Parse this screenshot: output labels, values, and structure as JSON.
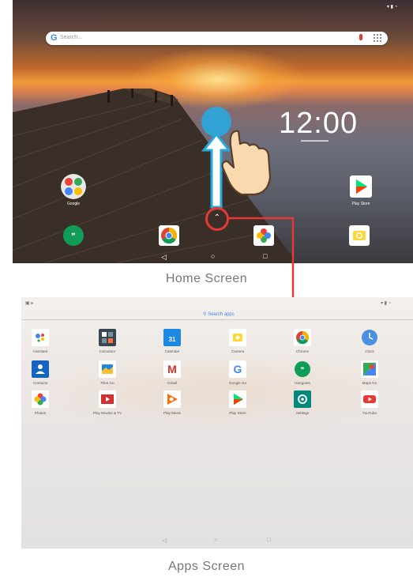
{
  "home": {
    "search": {
      "placeholder": "Search..."
    },
    "clock": {
      "time": "12:00"
    },
    "apps": [
      {
        "label": "Google"
      },
      {
        "label": "Play Store"
      }
    ]
  },
  "captions": {
    "home": "Home Screen",
    "apps": "Apps Screen"
  },
  "apps_screen": {
    "search_label": "Search apps",
    "grid": [
      {
        "label": "Assistant",
        "icon": "assistant-icon"
      },
      {
        "label": "Calculator",
        "icon": "calculator-icon"
      },
      {
        "label": "Calendar",
        "icon": "calendar-icon",
        "glyph": "31"
      },
      {
        "label": "Camera",
        "icon": "camera-icon"
      },
      {
        "label": "Chrome",
        "icon": "chrome-icon"
      },
      {
        "label": "Clock",
        "icon": "clock-icon"
      },
      {
        "label": "Contacts",
        "icon": "contacts-icon"
      },
      {
        "label": "Files Go",
        "icon": "files-go-icon"
      },
      {
        "label": "Gmail",
        "icon": "gmail-icon",
        "glyph": "M"
      },
      {
        "label": "Google Go",
        "icon": "google-go-icon",
        "glyph": "G"
      },
      {
        "label": "Hangouts",
        "icon": "hangouts-icon"
      },
      {
        "label": "Maps Go",
        "icon": "maps-go-icon"
      },
      {
        "label": "Photos",
        "icon": "photos-icon"
      },
      {
        "label": "Play Movies & TV",
        "icon": "play-movies-icon"
      },
      {
        "label": "Play Music",
        "icon": "play-music-icon"
      },
      {
        "label": "Play Store",
        "icon": "play-store-icon"
      },
      {
        "label": "Settings",
        "icon": "settings-icon"
      },
      {
        "label": "YouTube",
        "icon": "youtube-icon"
      }
    ]
  },
  "colors": {
    "annotation_red": "#e53935",
    "arrow_blue": "#29a8e0"
  }
}
